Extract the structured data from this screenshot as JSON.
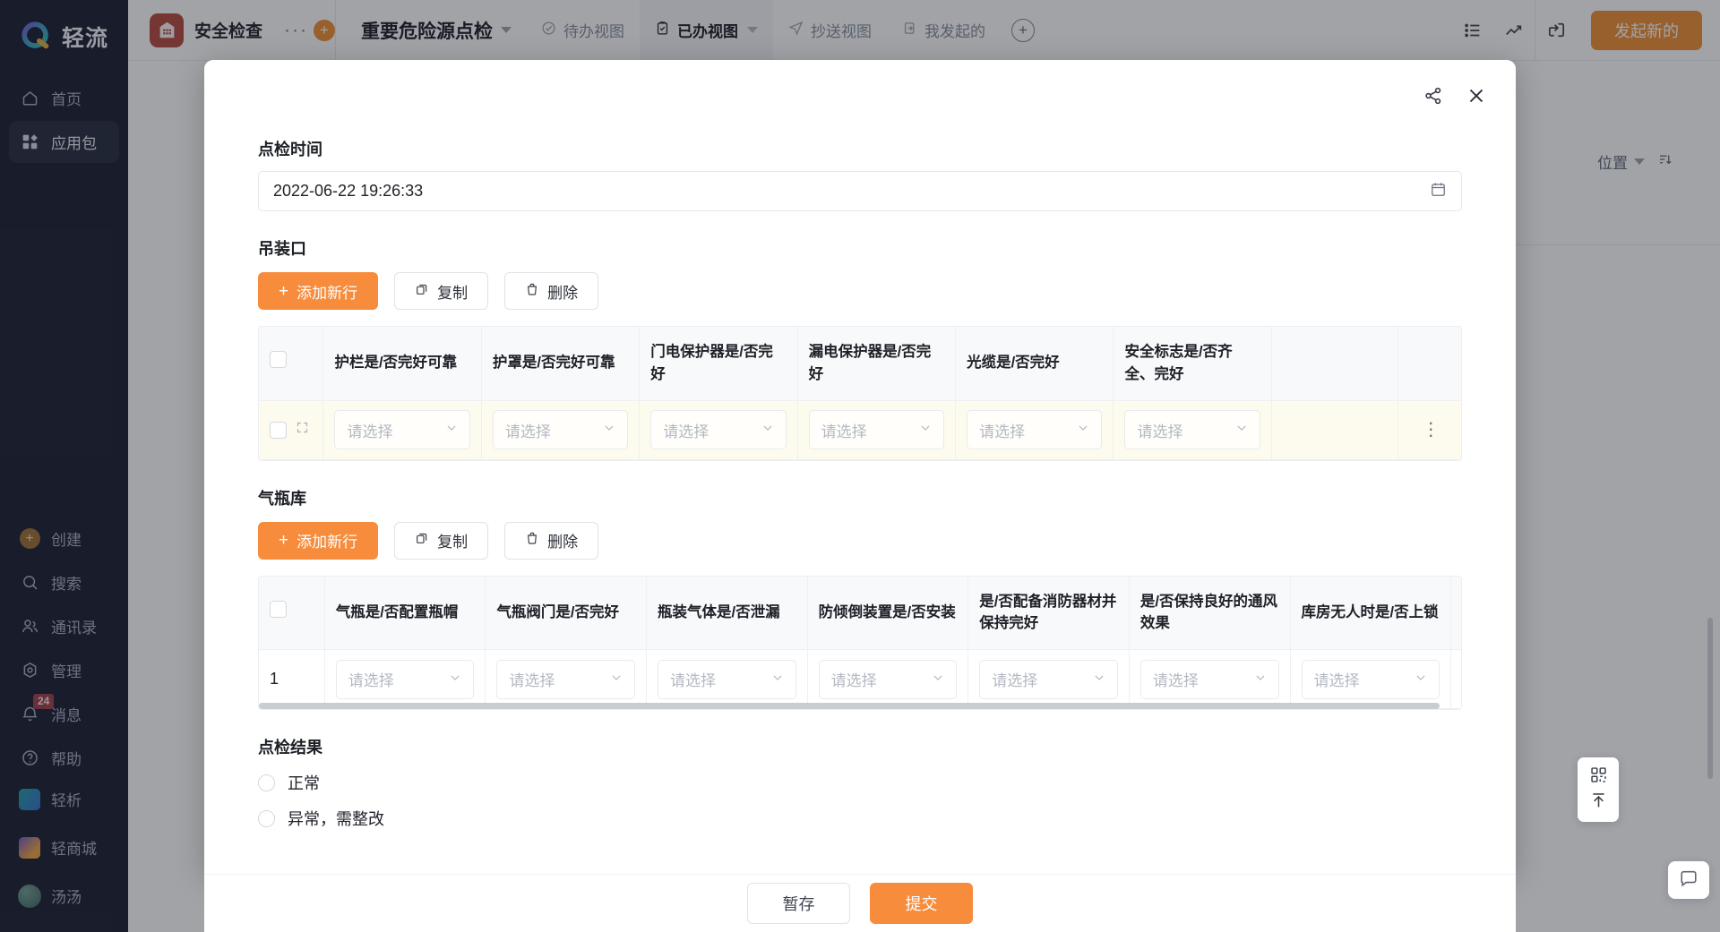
{
  "sidebar": {
    "brand": "轻流",
    "top_items": [
      {
        "label": "首页",
        "icon": "home-icon",
        "active": false
      },
      {
        "label": "应用包",
        "icon": "apps-icon",
        "active": true
      }
    ],
    "mid_items": [
      {
        "label": "创建",
        "icon": "plus-circle-icon",
        "badge": ""
      },
      {
        "label": "搜索",
        "icon": "search-icon",
        "badge": ""
      },
      {
        "label": "通讯录",
        "icon": "contacts-icon",
        "badge": ""
      },
      {
        "label": "管理",
        "icon": "settings-icon",
        "badge": ""
      },
      {
        "label": "消息",
        "icon": "bell-icon",
        "badge": "24"
      },
      {
        "label": "帮助",
        "icon": "help-circle-icon",
        "badge": ""
      }
    ],
    "lower_items": [
      {
        "label": "轻析",
        "icon": "qingxi-logo-icon"
      },
      {
        "label": "轻商城",
        "icon": "shop-logo-icon"
      },
      {
        "label": "汤汤",
        "icon": "avatar-icon"
      }
    ]
  },
  "topbar": {
    "app_name": "安全检查",
    "more_dots": "···",
    "add_app_label": "+",
    "flow_title": "重要危险源点检",
    "tabs": [
      {
        "label": "待办视图",
        "icon": "check-circle-icon",
        "active": false,
        "caret": false
      },
      {
        "label": "已办视图",
        "icon": "clipboard-check-icon",
        "active": true,
        "caret": true
      },
      {
        "label": "抄送视图",
        "icon": "send-icon",
        "active": false,
        "caret": false
      },
      {
        "label": "我发起的",
        "icon": "flag-icon",
        "active": false,
        "caret": false
      }
    ],
    "add_tab_label": "+",
    "right_icons": [
      "list-icon",
      "trend-chart-icon",
      "export-icon"
    ],
    "primary_button": "发起新的"
  },
  "behind": {
    "position_label": "位置",
    "filter_icon": "filter-icon",
    "sort_icon": "sort-icon"
  },
  "modal": {
    "share_icon": "share-icon",
    "close_icon": "close-icon",
    "datetime_field": {
      "label": "点检时间",
      "value": "2022-06-22 19:26:33",
      "calendar_icon": "calendar-icon"
    },
    "sections": [
      {
        "title": "吊装口",
        "buttons": [
          {
            "label": "添加新行",
            "style": "orange",
            "icon": "plus-icon"
          },
          {
            "label": "复制",
            "style": "ghost",
            "icon": "copy-icon"
          },
          {
            "label": "删除",
            "style": "ghost",
            "icon": "trash-icon"
          }
        ],
        "columns": [
          "护栏是/否完好可靠",
          "护罩是/否完好可靠",
          "门电保护器是/否完好",
          "漏电保护器是/否完好",
          "光缆是/否完好",
          "安全标志是/否齐全、完好"
        ],
        "rows": [
          {
            "index": "",
            "highlight": true,
            "expand_icon": "expand-icon",
            "cells": [
              "请选择",
              "请选择",
              "请选择",
              "请选择",
              "请选择",
              "请选择"
            ],
            "kebab": "⋮"
          }
        ],
        "has_blank_column": true,
        "scroll_ratio": 1.0
      },
      {
        "title": "气瓶库",
        "buttons": [
          {
            "label": "添加新行",
            "style": "orange",
            "icon": "plus-icon"
          },
          {
            "label": "复制",
            "style": "ghost",
            "icon": "copy-icon"
          },
          {
            "label": "删除",
            "style": "ghost",
            "icon": "trash-icon"
          }
        ],
        "columns": [
          "气瓶是/否配置瓶帽",
          "气瓶阀门是/否完好",
          "瓶装气体是/否泄漏",
          "防倾倒装置是/否安装",
          "是/否配备消防器材并保持完好",
          "是/否保持良好的通风效果",
          "库房无人时是/否上锁"
        ],
        "rows": [
          {
            "index": "1",
            "highlight": false,
            "expand_icon": "",
            "cells": [
              "请选择",
              "请选择",
              "请选择",
              "请选择",
              "请选择",
              "请选择",
              "请选择"
            ],
            "kebab": "⋮"
          }
        ],
        "has_blank_column": false,
        "scroll_ratio": 0.93
      }
    ],
    "result_field": {
      "label": "点检结果",
      "options": [
        {
          "label": "正常",
          "selected": false
        },
        {
          "label": "异常，需整改",
          "selected": false
        }
      ]
    },
    "footer": {
      "save_draft": "暂存",
      "submit": "提交"
    }
  },
  "widgets": {
    "qr_icon": "qr-code-icon",
    "scroll_top_icon": "arrow-up-icon",
    "chat_icon": "chat-icon"
  },
  "colors": {
    "accent_orange": "#f68c3c",
    "sidebar_bg": "#14182a",
    "badge_red": "#9b3a44"
  }
}
